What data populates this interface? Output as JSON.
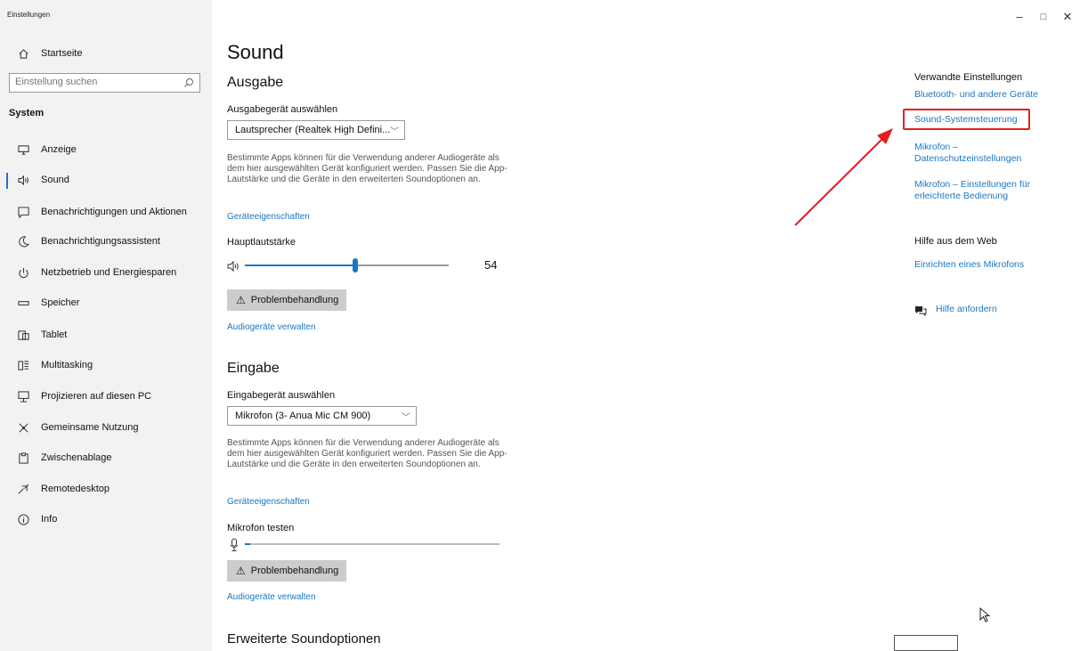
{
  "window": {
    "title": "Einstellungen",
    "minimize": "–",
    "maximize": "□",
    "close": "✕"
  },
  "sidebar": {
    "home": "Startseite",
    "search_placeholder": "Einstellung suchen",
    "section": "System",
    "items": [
      {
        "label": "Anzeige",
        "icon": "monitor-icon"
      },
      {
        "label": "Sound",
        "icon": "speaker-icon"
      },
      {
        "label": "Benachrichtigungen und Aktionen",
        "icon": "notification-icon"
      },
      {
        "label": "Benachrichtigungsassistent",
        "icon": "moon-icon"
      },
      {
        "label": "Netzbetrieb und Energiesparen",
        "icon": "power-icon"
      },
      {
        "label": "Speicher",
        "icon": "storage-icon"
      },
      {
        "label": "Tablet",
        "icon": "tablet-icon"
      },
      {
        "label": "Multitasking",
        "icon": "multitasking-icon"
      },
      {
        "label": "Projizieren auf diesen PC",
        "icon": "project-icon"
      },
      {
        "label": "Gemeinsame Nutzung",
        "icon": "share-icon"
      },
      {
        "label": "Zwischenablage",
        "icon": "clipboard-icon"
      },
      {
        "label": "Remotedesktop",
        "icon": "remote-icon"
      },
      {
        "label": "Info",
        "icon": "info-icon"
      }
    ]
  },
  "main": {
    "title": "Sound",
    "output": {
      "heading": "Ausgabe",
      "device_label": "Ausgabegerät auswählen",
      "device_value": "Lautsprecher (Realtek High Defini...",
      "description": "Bestimmte Apps können für die Verwendung anderer Audiogeräte als dem hier ausgewählten Gerät konfiguriert werden. Passen Sie die App-Lautstärke und die Geräte in den erweiterten Soundoptionen an.",
      "properties_link": "Geräteeigenschaften",
      "volume_label": "Hauptlautstärke",
      "volume_value": "54",
      "volume_level": 0.54,
      "troubleshoot": "Problembehandlung",
      "manage_link": "Audiogeräte verwalten"
    },
    "input": {
      "heading": "Eingabe",
      "device_label": "Eingabegerät auswählen",
      "device_value": "Mikrofon (3- Anua Mic CM 900)",
      "description": "Bestimmte Apps können für die Verwendung anderer Audiogeräte als dem hier ausgewählten Gerät konfiguriert werden. Passen Sie die App-Lautstärke und die Geräte in den erweiterten Soundoptionen an.",
      "properties_link": "Geräteeigenschaften",
      "test_label": "Mikrofon testen",
      "mic_level": 0.02,
      "troubleshoot": "Problembehandlung",
      "manage_link": "Audiogeräte verwalten"
    },
    "advanced_heading": "Erweiterte Soundoptionen"
  },
  "related": {
    "heading": "Verwandte Einstellungen",
    "links": [
      "Bluetooth- und andere Geräte",
      "Sound-Systemsteuerung",
      "Mikrofon – Datenschutzeinstellungen",
      "Mikrofon – Einstellungen für erleichterte Bedienung"
    ],
    "highlight_color": "#e02020"
  },
  "help": {
    "heading": "Hilfe aus dem Web",
    "link": "Einrichten eines Mikrofons",
    "get_help": "Hilfe anfordern"
  },
  "colors": {
    "accent": "#1a78c2",
    "annotation": "#e02020"
  }
}
